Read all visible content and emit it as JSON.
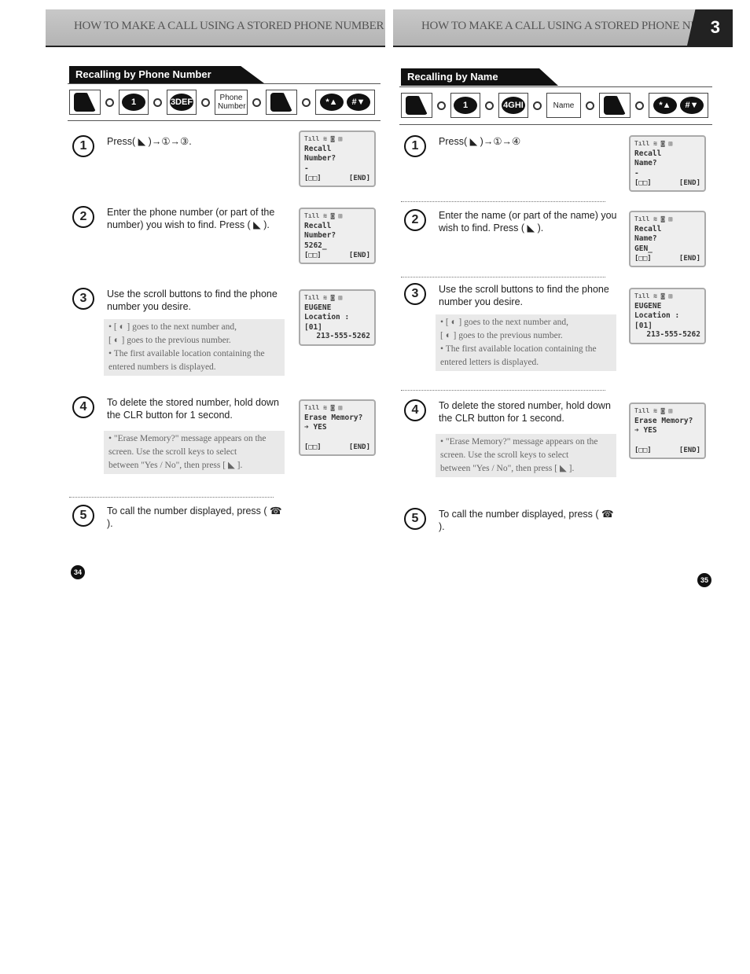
{
  "header": {
    "title_left": "HOW TO MAKE A CALL USING A STORED PHONE NUMBER",
    "title_right": "HOW TO MAKE A CALL USING A STORED PHONE NUMBER",
    "chapter": "3"
  },
  "left": {
    "section": "Recalling by Phone Number",
    "keys": [
      "menu-key",
      "1",
      "3DEF",
      "Phone Number",
      "menu-key",
      "*▲ #▼"
    ],
    "steps": [
      {
        "n": "1",
        "text": "Press( ◣ )→①→③."
      },
      {
        "n": "2",
        "text": "Enter the phone number (or part of the number) you wish to find. Press ( ◣ )."
      },
      {
        "n": "3",
        "text": "Use the scroll buttons to find the phone number you desire."
      },
      {
        "n": "4",
        "text": "To delete the stored number, hold down the CLR button for 1 second."
      },
      {
        "n": "5",
        "text": "To call the number displayed, press ( ☎ )."
      }
    ],
    "note3": [
      "• [ ◐ ] goes to the next number and,",
      "[ ◐ ] goes to the previous number.",
      "• The first available location containing the",
      "entered numbers is displayed."
    ],
    "note4": [
      "• \"Erase Memory?\" message appears on the",
      "screen. Use the scroll keys to select",
      "between \"Yes / No\", then press [ ◣ ]."
    ],
    "lcd": [
      {
        "l1": "Recall",
        "l2": "Number?",
        "l3": "-",
        "soft_l": "[□□]",
        "soft_r": "[END]"
      },
      {
        "l1": "Recall",
        "l2": "Number?",
        "l3": "5262_",
        "soft_l": "[□□]",
        "soft_r": "[END]"
      },
      {
        "l1": "EUGENE",
        "l2": "Location :   [01]",
        "l3": "",
        "phone": "213-555-5262"
      },
      {
        "l1": "Erase Memory?",
        "l2": "➔ YES",
        "l3": "",
        "soft_l": "[□□]",
        "soft_r": "[END]"
      }
    ],
    "page": "34"
  },
  "right": {
    "section": "Recalling by Name",
    "keys": [
      "menu-key",
      "1",
      "4GHI",
      "Name",
      "menu-key",
      "*▲ #▼"
    ],
    "steps": [
      {
        "n": "1",
        "text": "Press( ◣ )→①→④"
      },
      {
        "n": "2",
        "text": "Enter the name (or part of the name) you wish to find. Press ( ◣ )."
      },
      {
        "n": "3",
        "text": "Use the scroll buttons to find the phone number you desire."
      },
      {
        "n": "4",
        "text": "To delete the stored number, hold down the CLR button for 1 second."
      },
      {
        "n": "5",
        "text": "To call the number displayed, press ( ☎ )."
      }
    ],
    "note3": [
      "• [ ◐ ] goes to the next number and,",
      "[ ◐ ] goes to the previous number.",
      "• The first available location containing the",
      "entered letters is displayed."
    ],
    "note4": [
      "• \"Erase Memory?\" message appears on the",
      "screen. Use the scroll keys to select",
      "between \"Yes / No\", then press [ ◣ ]."
    ],
    "lcd": [
      {
        "l1": "Recall",
        "l2": "Name?",
        "l3": "-",
        "soft_l": "[□□]",
        "soft_r": "[END]"
      },
      {
        "l1": "Recall",
        "l2": "Name?",
        "l3": "GEN_",
        "soft_l": "[□□]",
        "soft_r": "[END]"
      },
      {
        "l1": "EUGENE",
        "l2": "Location :   [01]",
        "l3": "",
        "phone": "213-555-5262"
      },
      {
        "l1": "Erase Memory?",
        "l2": "➔ YES",
        "l3": "",
        "soft_l": "[□□]",
        "soft_r": "[END]"
      }
    ],
    "page": "35"
  },
  "status_icons": "Tıll  ≋      ◙ ▥"
}
